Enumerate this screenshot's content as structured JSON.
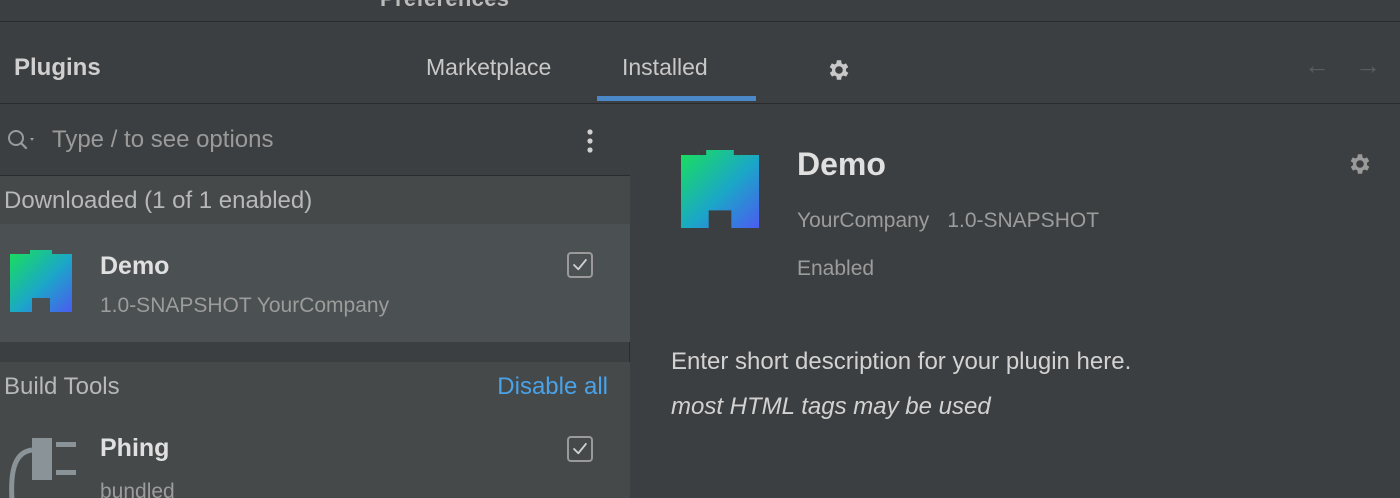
{
  "window": {
    "title": "Preferences"
  },
  "header": {
    "title": "Plugins",
    "tabs": [
      {
        "label": "Marketplace",
        "active": false
      },
      {
        "label": "Installed",
        "active": true
      }
    ],
    "nav_back": "←",
    "nav_forward": "→"
  },
  "search": {
    "placeholder": "Type / to see options",
    "value": ""
  },
  "sections": [
    {
      "label": "Downloaded (1 of 1 enabled)",
      "action": "",
      "plugins": [
        {
          "name": "Demo",
          "meta": "1.0-SNAPSHOT  YourCompany",
          "checked": true,
          "icon": "demo-plugin-icon"
        }
      ]
    },
    {
      "label": "Build Tools",
      "action": "Disable all",
      "plugins": [
        {
          "name": "Phing",
          "meta": "bundled",
          "checked": true,
          "icon": "plug-icon"
        }
      ]
    }
  ],
  "detail": {
    "name": "Demo",
    "vendor": "YourCompany",
    "version": "1.0-SNAPSHOT",
    "status": "Enabled",
    "description": "Enter short description for your plugin here.",
    "description_italic": "most HTML tags may be used"
  },
  "colors": {
    "background": "#3c3f41",
    "selected_row": "#4b5052",
    "section_header": "#45494a",
    "accent": "#4a88c7",
    "link": "#4aa2e8"
  }
}
